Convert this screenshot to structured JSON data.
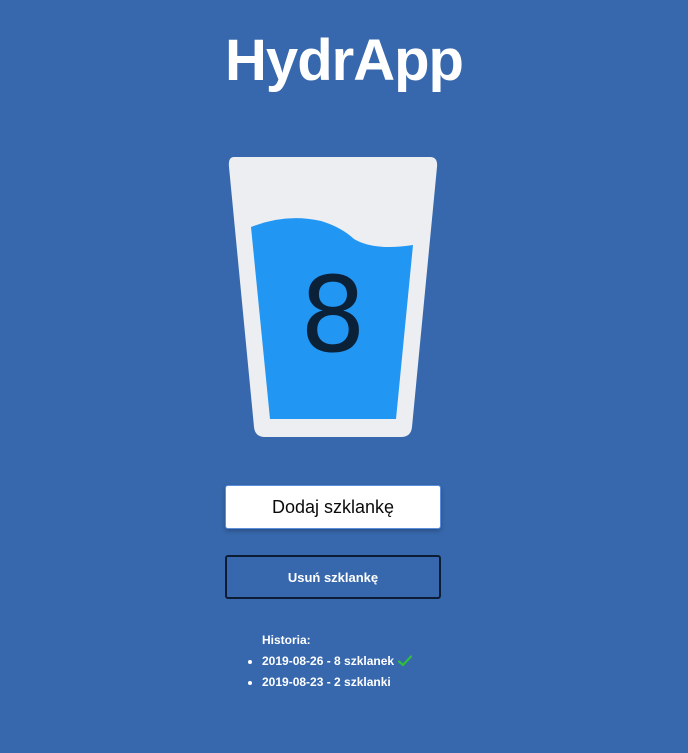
{
  "app": {
    "title": "HydrApp"
  },
  "glass": {
    "count": "8",
    "count_value": 8,
    "fill_level": 0.75,
    "glass_color": "#eceef1",
    "water_color": "#2196f3"
  },
  "buttons": {
    "add_label": "Dodaj szklankę",
    "remove_label": "Usuń szklankę"
  },
  "history": {
    "title": "Historia:",
    "entries": [
      {
        "text": "2019-08-26 - 8 szklanek",
        "goal_met": true,
        "icon": "check-icon"
      },
      {
        "text": "2019-08-23 - 2 szklanki",
        "goal_met": false
      }
    ]
  },
  "colors": {
    "background": "#3768ad",
    "check": "#2fbf3a"
  }
}
